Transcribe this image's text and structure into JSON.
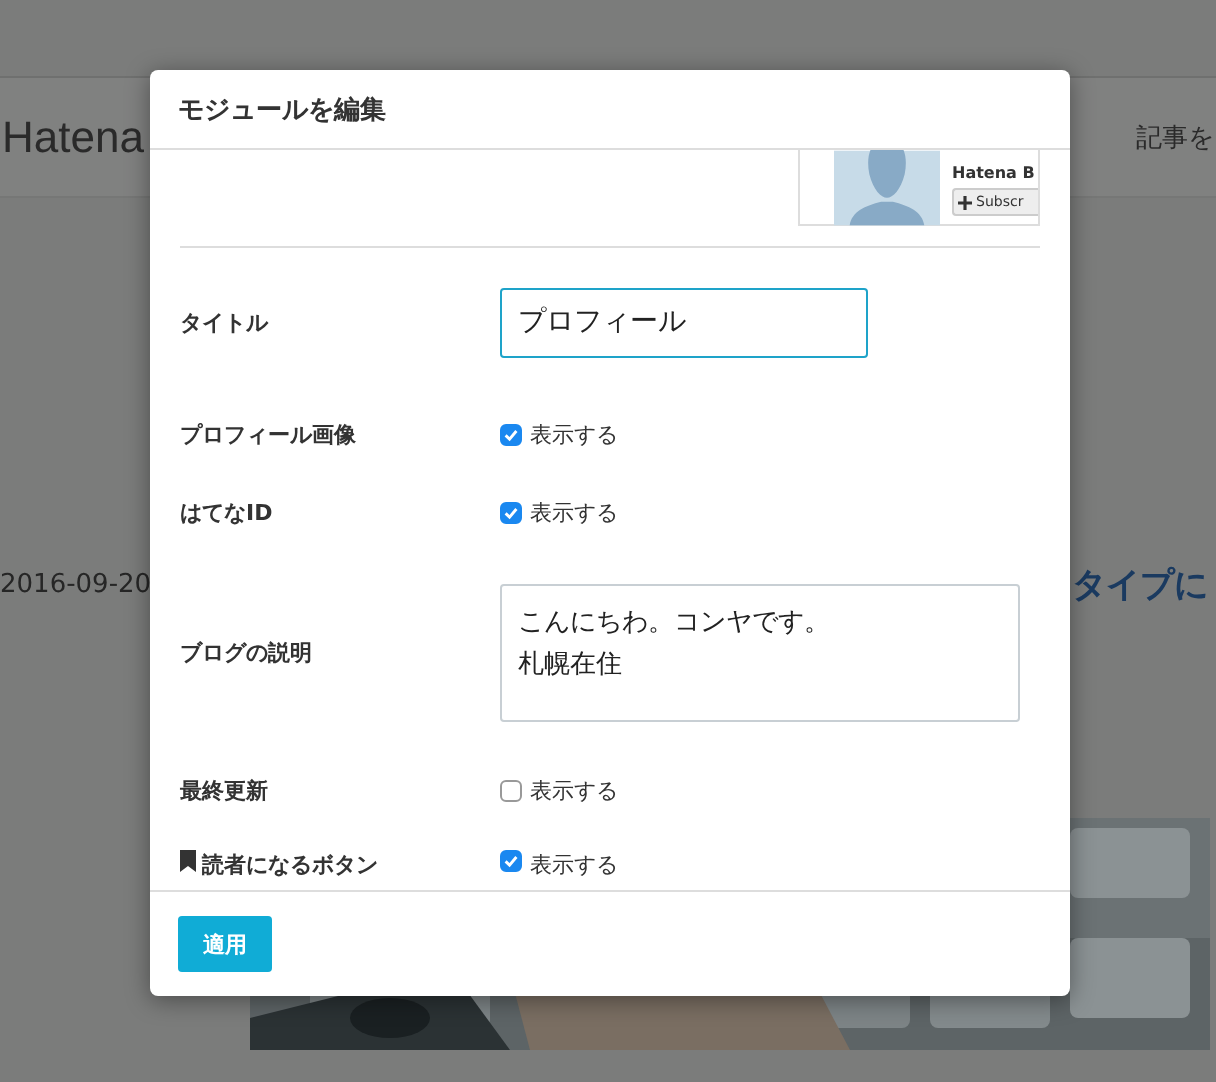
{
  "background": {
    "site_title": "Hatena",
    "header_link": "記事を",
    "date": "2016-09-20",
    "entry_title": "タイプに"
  },
  "dialog": {
    "title": "モジュールを編集",
    "preview": {
      "name": "Hatena B",
      "button": "Subscr"
    },
    "fields": [
      {
        "kind": "text",
        "label": "タイトル",
        "value": "プロフィール"
      },
      {
        "kind": "checkbox",
        "label": "プロフィール画像",
        "option": "表示する",
        "checked": true
      },
      {
        "kind": "checkbox",
        "label": "はてなID",
        "option": "表示する",
        "checked": true
      },
      {
        "kind": "textarea",
        "label": "ブログの説明",
        "lines": [
          "こんにちわ。コンヤです。",
          "札幌在住"
        ]
      },
      {
        "kind": "checkbox",
        "label": "最終更新",
        "option": "表示する",
        "checked": false
      },
      {
        "kind": "checkbox",
        "label": "読者になるボタン",
        "bookmark_icon": true,
        "option": "表示する",
        "checked": true
      }
    ],
    "apply_button": "適用"
  }
}
